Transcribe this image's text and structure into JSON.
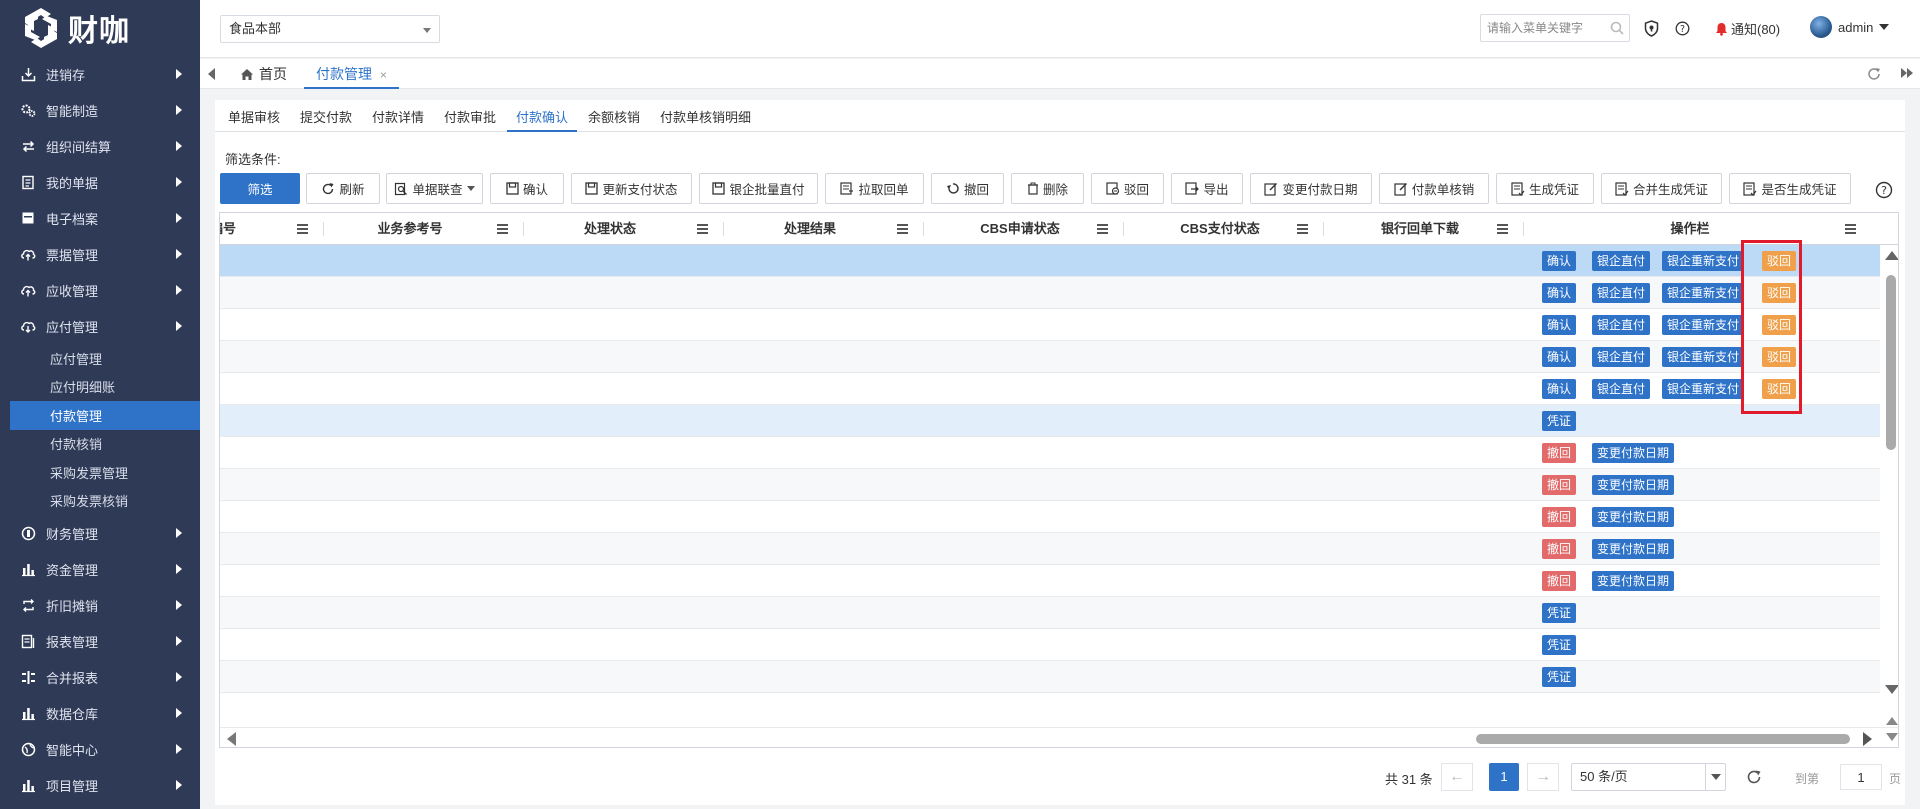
{
  "sidebar": {
    "logo_text": "财咖",
    "items": [
      {
        "label": "进销存",
        "icon": "download-box-icon"
      },
      {
        "label": "智能制造",
        "icon": "gears-icon"
      },
      {
        "label": "组织间结算",
        "icon": "swap-icon"
      },
      {
        "label": "我的单据",
        "icon": "document-list-icon"
      },
      {
        "label": "电子档案",
        "icon": "archive-icon"
      },
      {
        "label": "票据管理",
        "icon": "cloud-upload-icon"
      },
      {
        "label": "应收管理",
        "icon": "cloud-upload-icon"
      },
      {
        "label": "应付管理",
        "icon": "cloud-download-icon"
      }
    ],
    "sub_items": [
      {
        "label": "应付管理"
      },
      {
        "label": "应付明细账"
      },
      {
        "label": "付款管理"
      },
      {
        "label": "付款核销"
      },
      {
        "label": "采购发票管理"
      },
      {
        "label": "采购发票核销"
      }
    ],
    "items_after": [
      {
        "label": "财务管理",
        "icon": "coin-icon"
      },
      {
        "label": "资金管理",
        "icon": "bar-chart-icon"
      },
      {
        "label": "折旧摊销",
        "icon": "loop-icon"
      },
      {
        "label": "报表管理",
        "icon": "report-icon"
      },
      {
        "label": "合并报表",
        "icon": "merge-icon"
      },
      {
        "label": "数据仓库",
        "icon": "bar-chart-icon"
      },
      {
        "label": "智能中心",
        "icon": "globe-icon"
      },
      {
        "label": "项目管理",
        "icon": "bar-chart-icon"
      }
    ]
  },
  "topbar": {
    "org": "食品本部",
    "search_placeholder": "请输入菜单关键字",
    "notification": "通知(80)",
    "user": "admin"
  },
  "page_tabs": {
    "home": "首页",
    "current": "付款管理",
    "close": "×"
  },
  "sub_tabs": [
    "单据审核",
    "提交付款",
    "付款详情",
    "付款审批",
    "付款确认",
    "余额核销",
    "付款单核销明细"
  ],
  "filter_label": "筛选条件:",
  "toolbar": {
    "filter": "筛选",
    "refresh": "刷新",
    "linked_query": "单据联查",
    "confirm": "确认",
    "update_status": "更新支付状态",
    "bank_batch": "银企批量直付",
    "pull_receipt": "拉取回单",
    "revoke": "撤回",
    "delete": "删除",
    "reject": "驳回",
    "export": "导出",
    "change_date": "变更付款日期",
    "verify": "付款单核销",
    "gen_voucher": "生成凭证",
    "merge_voucher": "合并生成凭证",
    "is_voucher": "是否生成凭证"
  },
  "table": {
    "columns": [
      "编号",
      "业务参考号",
      "处理状态",
      "处理结果",
      "CBS申请状态",
      "CBS支付状态",
      "银行回单下载",
      "操作栏"
    ],
    "action_labels": {
      "confirm": "确认",
      "bank_pay": "银企直付",
      "bank_repay": "银企重新支付",
      "reject": "驳回",
      "voucher": "凭证",
      "revoke": "撤回",
      "change_date": "变更付款日期"
    },
    "rows": [
      {
        "type": "pay"
      },
      {
        "type": "pay"
      },
      {
        "type": "pay"
      },
      {
        "type": "pay"
      },
      {
        "type": "pay"
      },
      {
        "type": "voucher"
      },
      {
        "type": "revoke"
      },
      {
        "type": "revoke"
      },
      {
        "type": "revoke"
      },
      {
        "type": "revoke"
      },
      {
        "type": "revoke"
      },
      {
        "type": "voucher"
      },
      {
        "type": "voucher"
      },
      {
        "type": "voucher"
      }
    ]
  },
  "pager": {
    "total": "共 31 条",
    "prev": "←",
    "next": "→",
    "current": "1",
    "page_size": "50 条/页",
    "goto_label": "到第",
    "goto_value": "1",
    "unit": "页"
  },
  "colors": {
    "sidebar": "#2f3a57",
    "primary": "#2f73c9",
    "reject_orange": "#f0a04a",
    "revoke_red": "#e36a6a",
    "highlight_box": "#e21b2a"
  }
}
